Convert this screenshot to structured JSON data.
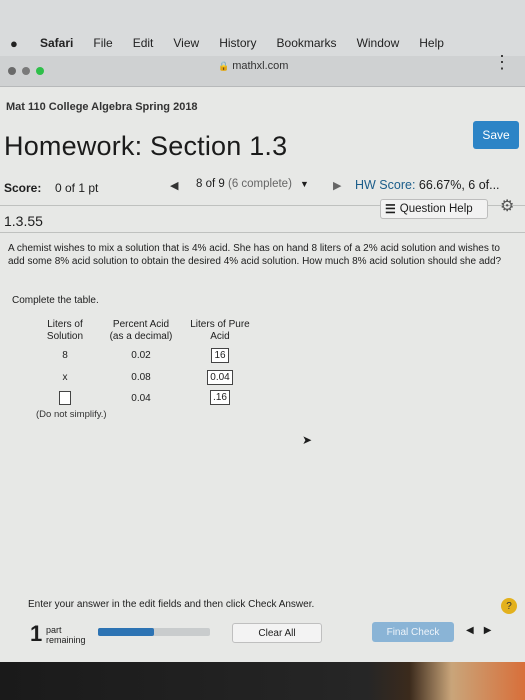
{
  "menubar": {
    "app": "Safari",
    "items": [
      "File",
      "Edit",
      "View",
      "History",
      "Bookmarks",
      "Window",
      "Help"
    ]
  },
  "browser": {
    "url": "mathxl.com"
  },
  "course": "Mat 110 College Algebra Spring 2018",
  "homework": {
    "title": "Homework: Section 1.3",
    "save_label": "Save",
    "score_label": "Score:",
    "score_value": "0 of 1 pt",
    "nav_text": "8 of 9",
    "nav_complete": "(6 complete)",
    "hw_score_label": "HW Score:",
    "hw_score_value": "66.67%, 6 of..."
  },
  "question": {
    "number": "1.3.55",
    "help_label": "Question Help",
    "text": "A chemist wishes to mix a solution that is 4% acid. She has on hand 8 liters of a 2% acid solution and wishes to add some 8% acid solution to obtain the desired 4% acid solution. How much 8% acid solution should she add?",
    "instruction": "Complete the table.",
    "table": {
      "headers": [
        "Liters of\nSolution",
        "Percent Acid\n(as a decimal)",
        "Liters of Pure\nAcid"
      ],
      "rows": [
        [
          "8",
          "0.02",
          "16"
        ],
        [
          "x",
          "0.08",
          "0.04"
        ],
        [
          "",
          "0.04",
          ".16"
        ]
      ]
    },
    "note": "(Do not simplify.)"
  },
  "footer": {
    "instruction": "Enter your answer in the edit fields and then click Check Answer.",
    "help_icon": "?",
    "part_number": "1",
    "part_label": "part\nremaining",
    "progress": 0.5,
    "clear_label": "Clear All",
    "final_label": "Final Check"
  },
  "colors": {
    "save_button": "#2c84c6",
    "final_check_button": "#8ab4d6",
    "help_circle": "#e3b11d",
    "progress_fill": "#2d73b3"
  }
}
